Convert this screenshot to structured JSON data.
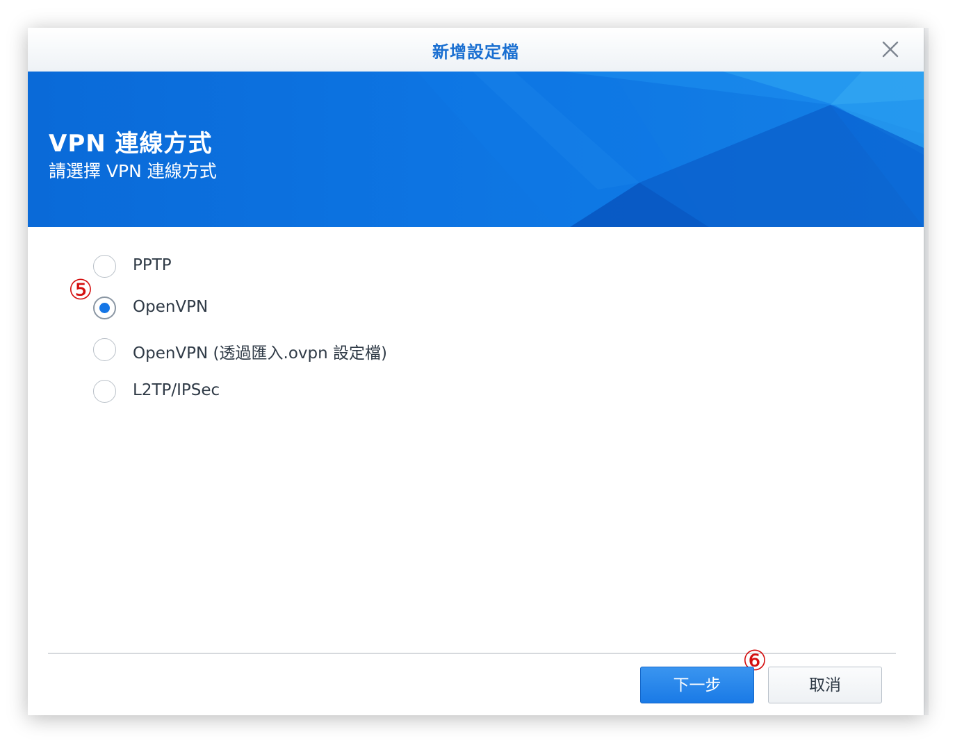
{
  "dialog": {
    "title": "新增設定檔"
  },
  "banner": {
    "title": "VPN 連線方式",
    "subtitle": "請選擇 VPN 連線方式"
  },
  "options": [
    {
      "label": "PPTP",
      "checked": false
    },
    {
      "label": "OpenVPN",
      "checked": true
    },
    {
      "label": "OpenVPN (透過匯入.ovpn 設定檔)",
      "checked": false
    },
    {
      "label": "L2TP/IPSec",
      "checked": false
    }
  ],
  "annotations": {
    "step5": "⑤",
    "step6": "⑥"
  },
  "buttons": {
    "next": "下一步",
    "cancel": "取消"
  },
  "colors": {
    "accent": "#1576e6",
    "title": "#1a6fd1",
    "annotation": "#d40f0f"
  },
  "icons": {
    "close": "close-icon"
  }
}
